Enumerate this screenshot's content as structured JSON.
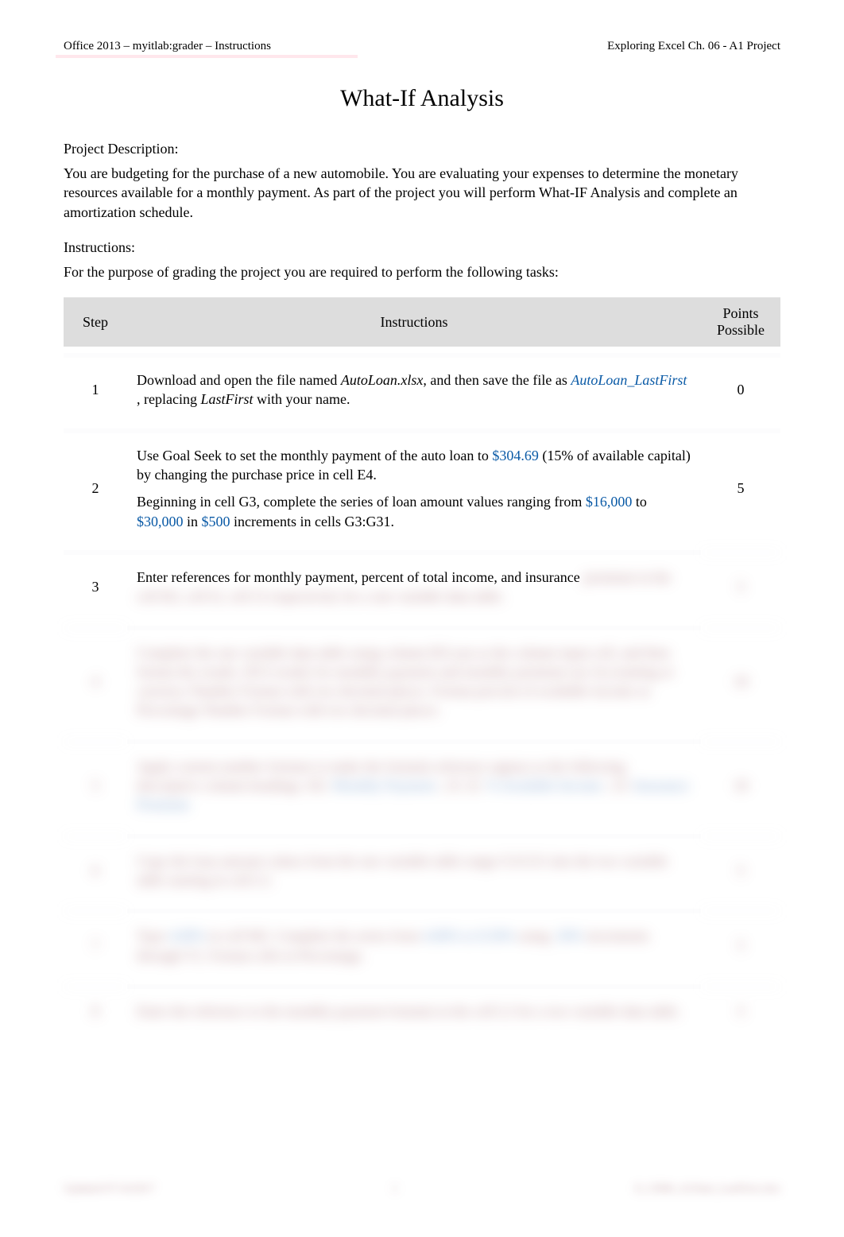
{
  "header": {
    "left": "Office 2013 – myitlab:grader – Instructions",
    "right": "Exploring Excel Ch. 06 - A1 Project"
  },
  "title": "What-If Analysis",
  "labels": {
    "project_description": "Project Description:",
    "instructions": "Instructions:",
    "grading_note": "For the purpose of grading the project you are required to perform the following tasks:"
  },
  "description": "You are budgeting for the purchase of a new automobile. You are evaluating your expenses to determine the monetary resources available for a monthly payment. As part of the project you will perform What-IF Analysis and complete an amortization schedule.",
  "table": {
    "head": {
      "step": "Step",
      "instructions": "Instructions",
      "points": "Points Possible"
    },
    "rows": [
      {
        "step": "1",
        "points": "0",
        "blurred": false,
        "segments": [
          {
            "t": "Download and open the file named "
          },
          {
            "t": "AutoLoan.xlsx",
            "italic": true
          },
          {
            "t": ", and then save the file as "
          },
          {
            "t": "AutoLoan_LastFirst ",
            "blue": true,
            "italic": true
          },
          {
            "t": ", replacing "
          },
          {
            "t": "LastFirst",
            "italic": true
          },
          {
            "t": " with your name."
          }
        ]
      },
      {
        "step": "2",
        "points": "5",
        "blurred": false,
        "segments": [
          {
            "t": "Use Goal Seek to set the monthly payment of the auto loan to "
          },
          {
            "t": "$304.69 ",
            "blue": true
          },
          {
            "t": "(15% of available capital) by changing the purchase price in cell E4."
          },
          {
            "break": true
          },
          {
            "t": "Beginning in cell G3, complete the series of loan amount values ranging from "
          },
          {
            "t": "$16,000 ",
            "blue": true
          },
          {
            "t": "to "
          },
          {
            "t": "$30,000 ",
            "blue": true
          },
          {
            "t": "in "
          },
          {
            "t": "$500 ",
            "blue": true
          },
          {
            "t": "increments in cells G3:G31."
          }
        ]
      },
      {
        "step": "3",
        "points": "5",
        "blurred_partial": true,
        "segments": [
          {
            "t": "Enter references for monthly payment, percent of total income, and insurance "
          },
          {
            "t": "premium in the cell H2, cell I2, cell J2 respectively for a one variable data table.",
            "blur": true
          }
        ]
      },
      {
        "step": "4",
        "points": "10",
        "blurred": true,
        "segments": [
          {
            "t": "Complete the one variable data table using column B/Loan as the column input cell, and then format the results. H3:I results for monthly payment and monthly premium use Accounting or currency Number Format with two decimal places. Format percent of available income as Percentage Number Format with two decimal places."
          }
        ]
      },
      {
        "step": "5",
        "points": "10",
        "blurred": true,
        "segments": [
          {
            "t": "Apply custom number formats to make the formula reference appear as the following descriptive column headings. H2: "
          },
          {
            "t": "Monthly Payment ",
            "blue": true
          },
          {
            "t": "; J2: I2: "
          },
          {
            "t": "% Available Income ",
            "blue": true
          },
          {
            "t": "; J2: "
          },
          {
            "t": "Insurance Premium",
            "blue": true
          }
        ]
      },
      {
        "step": "6",
        "points": "5",
        "blurred": true,
        "segments": [
          {
            "t": "Copy the loan amount values from the one variable table range G3:G31 into the two variable table starting in cell L3."
          }
        ]
      },
      {
        "step": "7",
        "points": "5",
        "blurred": true,
        "segments": [
          {
            "t": "Type "
          },
          {
            "t": "4.00% ",
            "blue": true
          },
          {
            "t": "in cell M2. Complete the series from "
          },
          {
            "t": "4.00% to 8.50% ",
            "blue": true
          },
          {
            "t": "using "
          },
          {
            "t": ".50% ",
            "blue": true
          },
          {
            "t": "increments through V2. Format cells in Percentage."
          }
        ]
      },
      {
        "step": "8",
        "points": "5",
        "blurred": true,
        "segments": [
          {
            "t": "Enter the reference to the monthly payment formula in the cell L2 for a two variable data table."
          }
        ]
      }
    ]
  },
  "footer": {
    "left": "Updated 07/14/2017",
    "center": "1",
    "right": "E_CH06_A1Start_LastFirst.xlsx"
  }
}
